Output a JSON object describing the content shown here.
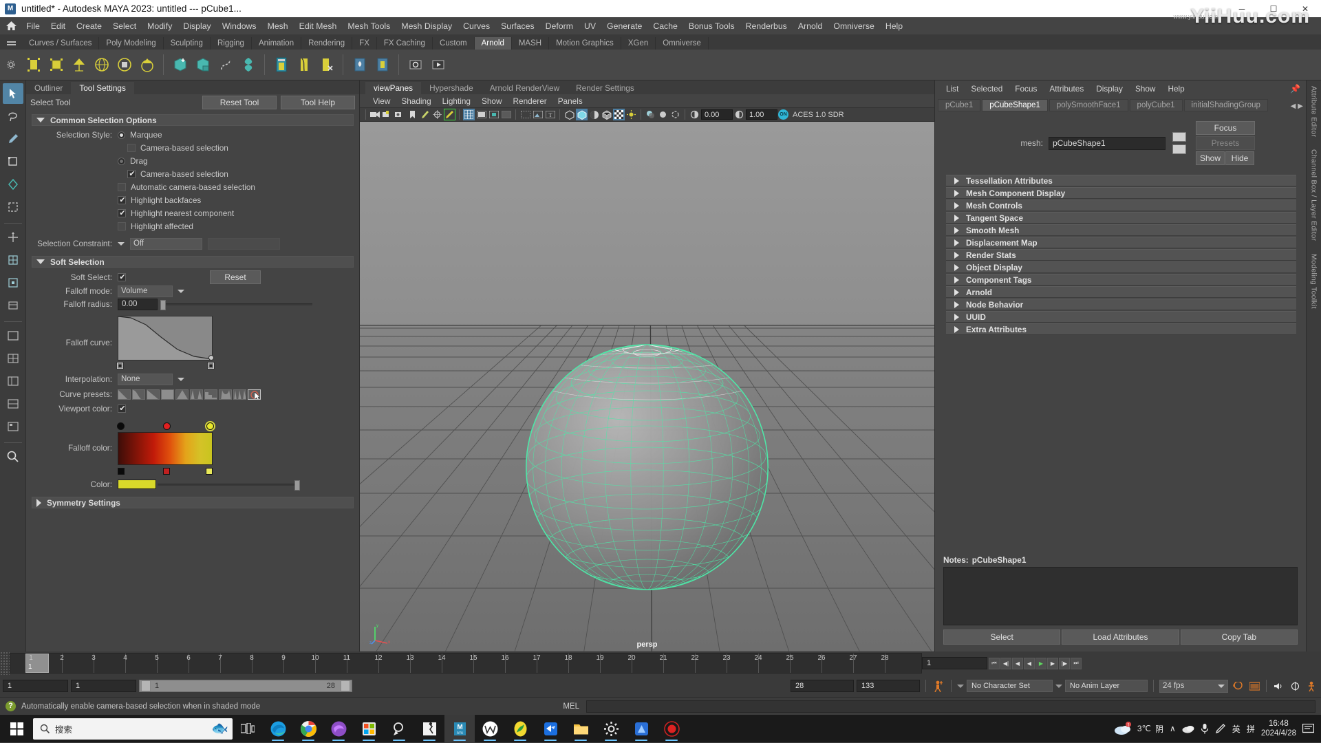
{
  "titlebar": {
    "title": "untitled* - Autodesk MAYA 2023: untitled   ---   pCube1...",
    "minimize": "─",
    "maximize": "☐",
    "close": "✕",
    "app_icon": "maya-logo-icon"
  },
  "watermark": {
    "text": "YiiHuu.com",
    "sub": "www.yiihuu.com"
  },
  "menubar": {
    "home_icon": "home-icon",
    "items": [
      "File",
      "Edit",
      "Create",
      "Select",
      "Modify",
      "Display",
      "Windows",
      "Mesh",
      "Edit Mesh",
      "Mesh Tools",
      "Mesh Display",
      "Curves",
      "Surfaces",
      "Deform",
      "UV",
      "Generate",
      "Cache",
      "Bonus Tools",
      "Renderbus",
      "Arnold",
      "Omniverse",
      "Help"
    ]
  },
  "shelf": {
    "tabs": [
      "Curves / Surfaces",
      "Poly Modeling",
      "Sculpting",
      "Rigging",
      "Animation",
      "Rendering",
      "FX",
      "FX Caching",
      "Custom",
      "Arnold",
      "MASH",
      "Motion Graphics",
      "XGen",
      "Omniverse"
    ],
    "active_tab": "Arnold",
    "icons": [
      "arnold-area-light-icon",
      "arnold-mesh-light-icon",
      "arnold-photometric-light-icon",
      "arnold-skydome-light-icon",
      "arnold-physical-sky-icon",
      "arnold-light-portal-icon",
      "arnold-standin-create-icon",
      "arnold-standin-export-icon",
      "arnold-curve-collector-icon",
      "arnold-volume-icon",
      "arnold-render-view-icon",
      "arnold-scene-source-icon",
      "arnold-flush-caches-icon",
      "arnold-light-manager-icon",
      "arnold-operator-icon",
      "arnold-open-render-icon",
      "arnold-play-sequence-icon"
    ]
  },
  "toolbox": {
    "icons": [
      "select-tool-icon",
      "lasso-select-icon",
      "paint-select-icon",
      "move-tool-icon",
      "rotate-tool-icon",
      "scale-tool-icon",
      "universal-manipulator-icon",
      "soft-modification-icon",
      "show-manipulator-icon",
      "last-tool-icon",
      "layout-single-icon",
      "layout-four-view-icon",
      "layout-persp-outliner-icon",
      "layout-persp-graph-icon",
      "layout-hypershade-icon",
      "magnify-icon"
    ],
    "selected": "select-tool-icon"
  },
  "tool_settings": {
    "tabs": [
      "Outliner",
      "Tool Settings"
    ],
    "active_tab": "Tool Settings",
    "tool_name": "Select Tool",
    "reset_tool": "Reset Tool",
    "tool_help": "Tool Help",
    "sections": {
      "common": {
        "title": "Common Selection Options",
        "selection_style_label": "Selection Style:",
        "marquee": "Marquee",
        "marquee_camera_based": "Camera-based selection",
        "drag": "Drag",
        "drag_camera_based": "Camera-based selection",
        "automatic_camera_based": "Automatic camera-based selection",
        "highlight_backfaces": "Highlight backfaces",
        "highlight_nearest_component": "Highlight nearest component",
        "highlight_affected": "Highlight affected",
        "selection_constraint_label": "Selection Constraint:",
        "selection_constraint_value": "Off",
        "checks": {
          "marquee_camera_based": false,
          "drag_camera_based": true,
          "automatic_camera_based": false,
          "highlight_backfaces": true,
          "highlight_nearest_component": true,
          "highlight_affected": false
        },
        "selected_style": "Marquee"
      },
      "soft_selection": {
        "title": "Soft Selection",
        "soft_select_label": "Soft Select:",
        "soft_select_checked": true,
        "reset": "Reset",
        "falloff_mode_label": "Falloff mode:",
        "falloff_mode_value": "Volume",
        "falloff_radius_label": "Falloff radius:",
        "falloff_radius_value": "0.00",
        "falloff_curve_label": "Falloff curve:",
        "interpolation_label": "Interpolation:",
        "interpolation_value": "None",
        "curve_presets_label": "Curve presets:",
        "viewport_color_label": "Viewport color:",
        "viewport_color_checked": true,
        "falloff_color_label": "Falloff color:",
        "color_label": "Color:",
        "color_value": "#d9d92a"
      },
      "symmetry": {
        "title": "Symmetry Settings"
      }
    }
  },
  "viewport": {
    "tabs": [
      "viewPanes",
      "Hypershade",
      "Arnold RenderView",
      "Render Settings"
    ],
    "active_tab": "viewPanes",
    "menus": [
      "View",
      "Shading",
      "Lighting",
      "Show",
      "Renderer",
      "Panels"
    ],
    "exposure_value": "0.00",
    "gamma_value": "1.00",
    "color_mode_toggle": "ON",
    "color_space": "ACES 1.0 SDR",
    "camera_label": "persp",
    "toolbar_icons": [
      "camera-icon",
      "camera-lock-icon",
      "camera-unlock-icon",
      "bookmark-icon",
      "paint-effects-icon",
      "reference-icon",
      "grease-pencil-icon",
      "grid-toggle-icon",
      "film-gate-icon",
      "resolution-gate-icon",
      "gate-mask-icon",
      "xray-icon",
      "image-plane-icon",
      "text-icon",
      "wireframe-icon",
      "shaded-icon",
      "shaded-textured-icon",
      "wireframe-on-shaded-icon",
      "texture-icon",
      "lighting-icon",
      "shadow-icon",
      "ao-icon",
      "motion-blur-icon"
    ]
  },
  "attribute_editor": {
    "menus": [
      "List",
      "Selected",
      "Focus",
      "Attributes",
      "Display",
      "Show",
      "Help"
    ],
    "pin_icon": "pin-icon",
    "node_tabs": [
      "pCube1",
      "pCubeShape1",
      "polySmoothFace1",
      "polyCube1",
      "initialShadingGroup"
    ],
    "active_node_tab": "pCubeShape1",
    "nav_prev": "◀",
    "nav_next": "▶",
    "mesh_label": "mesh:",
    "mesh_value": "pCubeShape1",
    "focus_button": "Focus",
    "presets_button": "Presets",
    "show_button": "Show",
    "hide_button": "Hide",
    "attribute_sections": [
      "Tessellation Attributes",
      "Mesh Component Display",
      "Mesh Controls",
      "Tangent Space",
      "Smooth Mesh",
      "Displacement Map",
      "Render Stats",
      "Object Display",
      "Component Tags",
      "Arnold",
      "Node Behavior",
      "UUID",
      "Extra Attributes"
    ],
    "notes_label": "Notes:",
    "notes_target": "pCubeShape1",
    "buttons": [
      "Select",
      "Load Attributes",
      "Copy Tab"
    ],
    "side_tabs": [
      "Attribute Editor",
      "Channel Box / Layer Editor",
      "Modeling Toolkit"
    ]
  },
  "timeline": {
    "ticks": [
      1,
      2,
      3,
      4,
      5,
      6,
      7,
      8,
      9,
      10,
      11,
      12,
      13,
      14,
      15,
      16,
      17,
      18,
      19,
      20,
      21,
      22,
      23,
      24,
      25,
      26,
      27,
      28
    ],
    "current_frame": "1",
    "start_field": "1",
    "end_field": "1",
    "range_start": "1",
    "range_end": "28",
    "anim_start": "28",
    "anim_end": "133",
    "playback_field": "1",
    "character_set": "No Character Set",
    "anim_layer": "No Anim Layer",
    "fps": "24 fps",
    "icons": [
      "go-to-start-icon",
      "step-back-key-icon",
      "step-back-frame-icon",
      "play-backwards-icon",
      "play-forwards-icon",
      "step-forward-frame-icon",
      "step-forward-key-icon",
      "go-to-end-icon",
      "auto-key-icon",
      "animation-prefs-icon",
      "loop-icon",
      "playblast-icon",
      "sound-icon",
      "key-tick-icon",
      "character-icon"
    ]
  },
  "statusbar": {
    "help_icon": "help-icon",
    "message": "Automatically enable camera-based selection when in shaded mode",
    "mel_label": "MEL",
    "command_value": ""
  },
  "taskbar": {
    "start_icon": "windows-start-icon",
    "search_placeholder": "搜索",
    "search_icon": "search-icon",
    "apps": [
      "task-view-icon",
      "edge-icon",
      "chrome-icon",
      "other-browser-icon",
      "microsoft-store-icon",
      "search-app-icon",
      "runner-app-icon",
      "maya-app-icon",
      "wps-icon",
      "oval-green-app-icon",
      "blue-bird-app-icon",
      "file-explorer-icon",
      "settings-icon",
      "photoshop-like-icon",
      "record-app-icon"
    ],
    "active_app": "maya-app-icon",
    "tray": {
      "weather_icon": "weather-cloud-icon",
      "weather_badge": "1",
      "temperature": "3℃",
      "weather_text": "阴",
      "chevron": "∧",
      "cloud_icon": "onedrive-icon",
      "mic_icon": "microphone-icon",
      "pen_icon": "pen-icon",
      "ime_lang": "英",
      "ime_pinyin": "拼",
      "time": "16:48",
      "date": "2024/4/28",
      "notification_icon": "notification-icon"
    }
  }
}
